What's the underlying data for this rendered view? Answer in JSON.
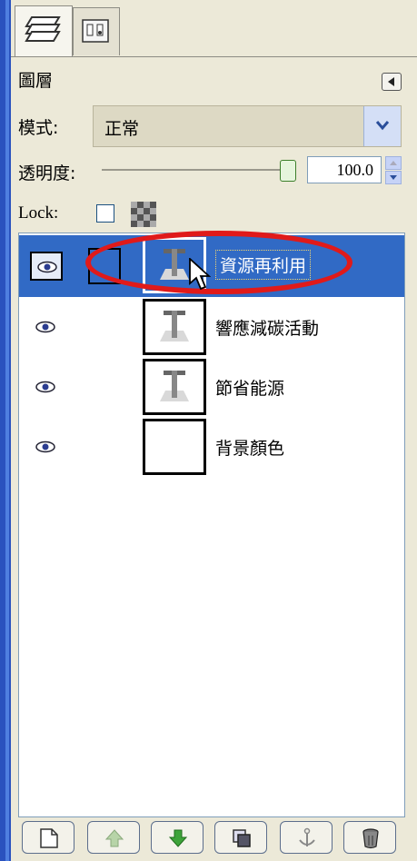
{
  "tabs": [
    {
      "icon": "layers-stack-icon"
    },
    {
      "icon": "channels-icon"
    }
  ],
  "panel": {
    "title": "圖層",
    "menu_icon": "panel-menu-icon"
  },
  "mode": {
    "label": "模式:",
    "value": "正常"
  },
  "opacity": {
    "label": "透明度:",
    "value": "100.0",
    "level": 1.0
  },
  "lock": {
    "label": "Lock:"
  },
  "layers": [
    {
      "name": "資源再利用",
      "selected": true,
      "visible": true,
      "type": "text"
    },
    {
      "name": "響應減碳活動",
      "selected": false,
      "visible": true,
      "type": "text"
    },
    {
      "name": "節省能源",
      "selected": false,
      "visible": true,
      "type": "text"
    },
    {
      "name": "背景顏色",
      "selected": false,
      "visible": true,
      "type": "blank"
    }
  ],
  "toolbar": [
    {
      "icon": "new-layer-icon"
    },
    {
      "icon": "raise-layer-icon"
    },
    {
      "icon": "lower-layer-icon"
    },
    {
      "icon": "duplicate-layer-icon"
    },
    {
      "icon": "anchor-layer-icon"
    },
    {
      "icon": "delete-layer-icon"
    }
  ],
  "colors": {
    "selection": "#316ac5",
    "highlight_ring": "#e01a1a"
  }
}
